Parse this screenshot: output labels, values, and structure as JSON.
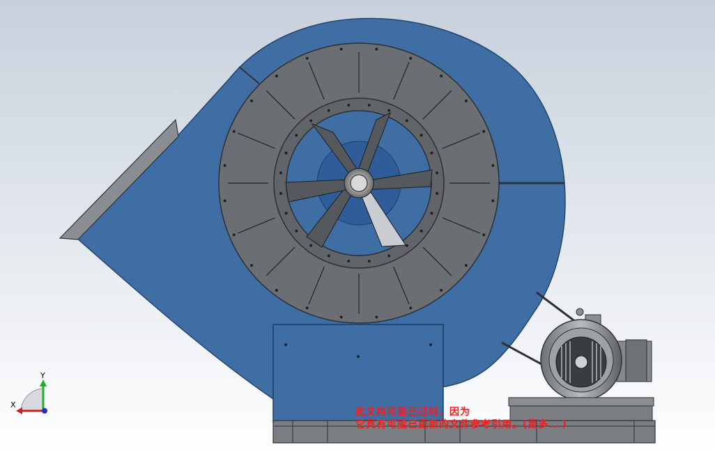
{
  "viewport": {
    "background_top": "#c9d2dd",
    "background_bottom": "#ffffff",
    "housing_color": "#3e6ea4",
    "disc_color": "#6b6e73",
    "base_color": "#7b7e83"
  },
  "triad": {
    "x_label": "X",
    "y_label": "Y",
    "x_color": "#cc1e1e",
    "y_color": "#1fae2b",
    "z_color": "#2130cc"
  },
  "watermark": {
    "line1": "此文档可能已过时，因为",
    "line2": "它具有可能已更新的文件参考引用。(更多...)",
    "color": "#ff1a1a"
  }
}
